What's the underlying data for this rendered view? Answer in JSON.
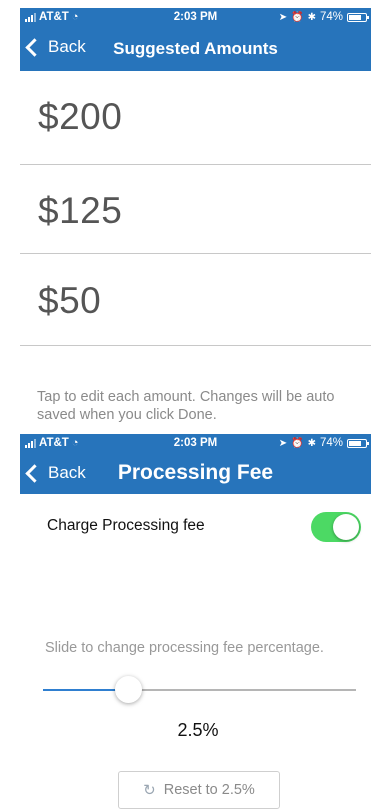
{
  "top_screen": {
    "status": {
      "carrier": "AT&T",
      "time": "2:03 PM",
      "battery": "74%",
      "battery_level": 0.74
    },
    "nav": {
      "back_label": "Back",
      "title": "Suggested Amounts"
    },
    "amounts": [
      "$200",
      "$125",
      "$50"
    ],
    "hint": "Tap to edit each amount. Changes will be auto saved when you click Done."
  },
  "bottom_screen": {
    "status": {
      "carrier": "AT&T",
      "time": "2:03 PM",
      "battery": "74%",
      "battery_level": 0.74
    },
    "nav": {
      "back_label": "Back",
      "title": "Processing Fee"
    },
    "fee_toggle": {
      "label": "Charge Processing fee",
      "on": true
    },
    "slide_hint": "Slide to change processing fee percentage.",
    "slider": {
      "fraction": 0.27
    },
    "fee_value": "2.5%",
    "reset_label": "Reset to 2.5%"
  },
  "colors": {
    "header_blue": "#2774bb",
    "toggle_on": "#4cd964",
    "slider_fill": "#2f7fd0"
  },
  "icons": {
    "back": "chevron-left-icon",
    "wifi": "wifi-icon",
    "reset": "refresh-icon"
  }
}
